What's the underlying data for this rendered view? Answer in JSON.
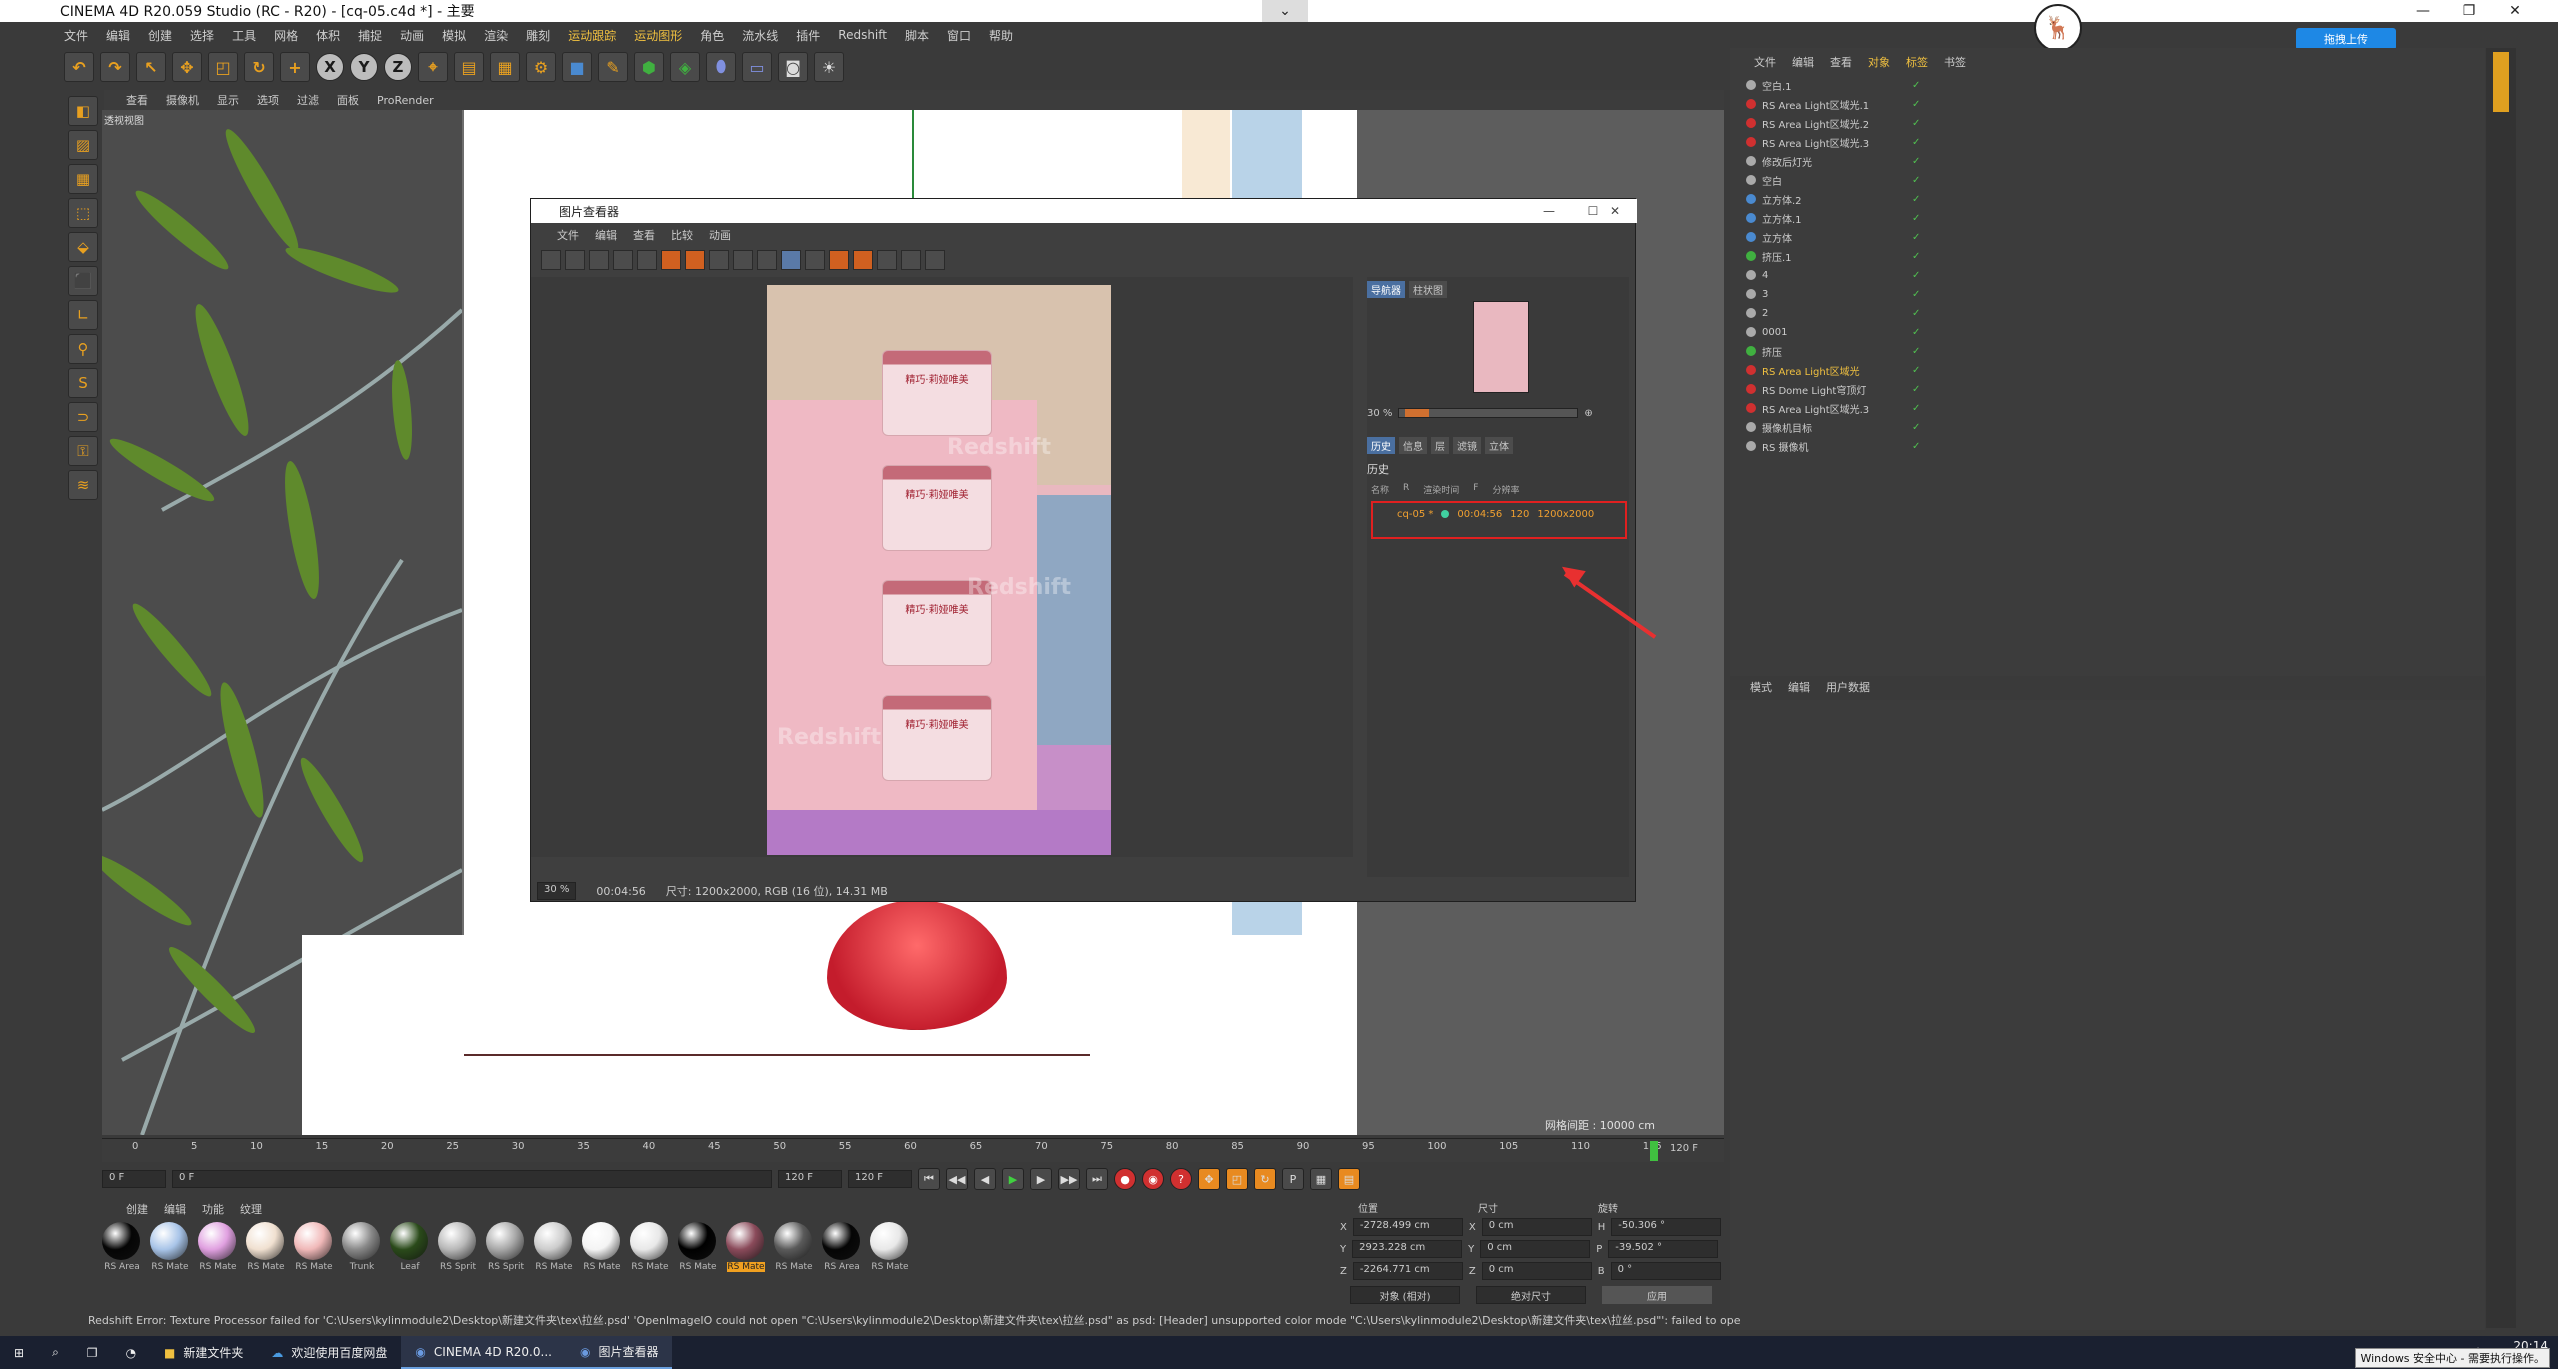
{
  "window": {
    "title": "CINEMA 4D R20.059 Studio (RC - R20) - [cq-05.c4d *] - 主要"
  },
  "menu": [
    "文件",
    "编辑",
    "创建",
    "选择",
    "工具",
    "网格",
    "体积",
    "捕捉",
    "动画",
    "模拟",
    "渲染",
    "雕刻",
    "运动跟踪",
    "运动图形",
    "角色",
    "流水线",
    "插件",
    "Redshift",
    "脚本",
    "窗口",
    "帮助"
  ],
  "viewport": {
    "menu": [
      "查看",
      "摄像机",
      "显示",
      "选项",
      "过滤",
      "面板",
      "ProRender"
    ],
    "label": "透视视图",
    "grid_info": "网格间距 : 10000 cm"
  },
  "picture_viewer": {
    "title": "图片查看器",
    "menu": [
      "文件",
      "编辑",
      "查看",
      "比较",
      "动画"
    ],
    "jar_text": "精巧·莉娅唯美",
    "watermark": "Redshift",
    "side_tabs": [
      "导航器",
      "柱状图"
    ],
    "zoom": "30 %",
    "zoom_level": 0.3,
    "hist_tabs": [
      "历史",
      "信息",
      "层",
      "滤镜",
      "立体"
    ],
    "hist_title": "历史",
    "hist_headers": [
      "名称",
      "R",
      "渲染时间",
      "F",
      "分辨率"
    ],
    "hist_row": {
      "name": "cq-05 *",
      "time": "00:04:56",
      "frame": "120",
      "res": "1200x2000"
    },
    "status": {
      "zoom": "30 %",
      "time": "00:04:56",
      "info": "尺寸: 1200x2000, RGB (16 位), 14.31 MB"
    }
  },
  "object_manager": {
    "menu": [
      "文件",
      "编辑",
      "查看",
      "对象",
      "标签",
      "书签"
    ],
    "items": [
      {
        "name": "空白.1",
        "color": "gray"
      },
      {
        "name": "RS Area Light区域光.1",
        "color": "red"
      },
      {
        "name": "RS Area Light区域光.2",
        "color": "red"
      },
      {
        "name": "RS Area Light区域光.3",
        "color": "red"
      },
      {
        "name": "修改后灯光",
        "color": "gray"
      },
      {
        "name": "空白",
        "color": "gray"
      },
      {
        "name": "立方体.2",
        "color": "blue"
      },
      {
        "name": "立方体.1",
        "color": "blue"
      },
      {
        "name": "立方体",
        "color": "blue"
      },
      {
        "name": "挤压.1",
        "color": "green"
      },
      {
        "name": "4",
        "color": "gray"
      },
      {
        "name": "3",
        "color": "gray"
      },
      {
        "name": "2",
        "color": "gray"
      },
      {
        "name": "0001",
        "color": "gray"
      },
      {
        "name": "挤压",
        "color": "green"
      },
      {
        "name": "RS Area Light区域光",
        "color": "red",
        "highlight": true
      },
      {
        "name": "RS Dome Light穹顶灯",
        "color": "red"
      },
      {
        "name": "RS Area Light区域光.3",
        "color": "red"
      },
      {
        "name": "摄像机目标",
        "color": "gray"
      },
      {
        "name": "RS 摄像机",
        "color": "gray"
      }
    ]
  },
  "attribute_manager": {
    "menu": [
      "模式",
      "编辑",
      "用户数据"
    ]
  },
  "timeline": {
    "ticks": [
      "0",
      "5",
      "10",
      "15",
      "20",
      "25",
      "30",
      "35",
      "40",
      "45",
      "50",
      "55",
      "60",
      "65",
      "70",
      "75",
      "80",
      "85",
      "90",
      "95",
      "100",
      "105",
      "110",
      "115"
    ],
    "end": "120 F",
    "current": "0 F",
    "start_field": "0 F",
    "end_field": "120 F",
    "range_end": "120 F"
  },
  "materials": {
    "menu": [
      "创建",
      "编辑",
      "功能",
      "纹理"
    ],
    "items": [
      {
        "label": "RS Area",
        "color": "#050505"
      },
      {
        "label": "RS Mate",
        "color": "#a8c4e8"
      },
      {
        "label": "RS Mate",
        "color": "#e0a0e0"
      },
      {
        "label": "RS Mate",
        "color": "#f0e0d0"
      },
      {
        "label": "RS Mate",
        "color": "#f0b8b8"
      },
      {
        "label": "Trunk",
        "color": "#888888"
      },
      {
        "label": "Leaf",
        "color": "#2a4a1a"
      },
      {
        "label": "RS Sprit",
        "color": "#b8b8b8"
      },
      {
        "label": "RS Sprit",
        "color": "#a8a8a8"
      },
      {
        "label": "RS Mate",
        "color": "#cccccc"
      },
      {
        "label": "RS Mate",
        "color": "#f4f4f4"
      },
      {
        "label": "RS Mate",
        "color": "#e8e8e8"
      },
      {
        "label": "RS Mate",
        "color": "#000000"
      },
      {
        "label": "RS Mate",
        "color": "#8a4a5a",
        "selected": true
      },
      {
        "label": "RS Mate",
        "color": "#5a5a5a"
      },
      {
        "label": "RS Area",
        "color": "#050505"
      },
      {
        "label": "RS Mate",
        "color": "#e8e8e8"
      }
    ]
  },
  "coords": {
    "headers": [
      "位置",
      "尺寸",
      "旋转"
    ],
    "x": {
      "pos": "-2728.499 cm",
      "size": "0 cm",
      "rot": "-50.306 °"
    },
    "y": {
      "pos": "2923.228 cm",
      "size": "0 cm",
      "rot": "-39.502 °"
    },
    "z": {
      "pos": "-2264.771 cm",
      "size": "0 cm",
      "rot": "0 °"
    },
    "axis_labels": {
      "x": "X",
      "y": "Y",
      "z": "Z",
      "h": "H",
      "p": "P",
      "b": "B"
    },
    "mode": "对象 (相对)",
    "size_mode": "绝对尺寸",
    "apply": "应用"
  },
  "status_line": "Redshift Error: Texture Processor failed for 'C:\\Users\\kylinmodule2\\Desktop\\新建文件夹\\tex\\拉丝.psd' 'OpenImageIO could not open \"C:\\Users\\kylinmodule2\\Desktop\\新建文件夹\\tex\\拉丝.psd\" as psd: [Header] unsupported color mode \"C:\\Users\\kylinmodule2\\Desktop\\新建文件夹\\tex\\拉丝.psd\"': failed to open file'",
  "upload_button": "拖拽上传",
  "taskbar": {
    "items": [
      "新建文件夹",
      "欢迎使用百度网盘",
      "CINEMA 4D R20.0...",
      "图片查看器"
    ],
    "time": "20:14",
    "tooltip": "Windows 安全中心 - 需要执行操作。"
  },
  "colors": {
    "accent": "#e8a020",
    "highlight_box": "#e02020",
    "arrow": "#e83030"
  }
}
